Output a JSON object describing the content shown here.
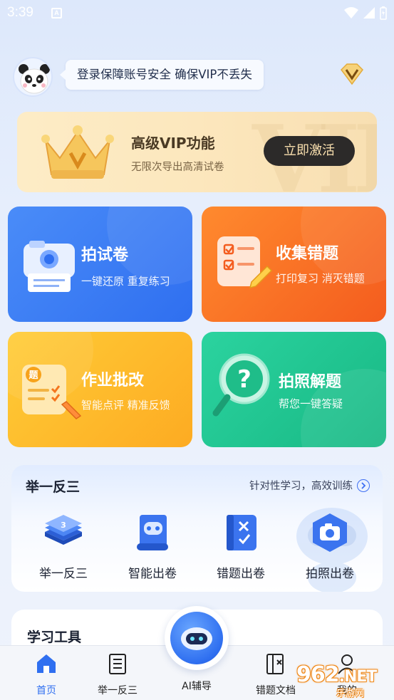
{
  "status_bar": {
    "time": "3:39",
    "notification_glyph": "A"
  },
  "header": {
    "notice": "登录保障账号安全 确保VIP不丢失"
  },
  "vip_banner": {
    "title": "高级VIP功能",
    "subtitle": "无限次导出高清试卷",
    "button": "立即激活",
    "watermark_text": "VIP"
  },
  "cards": [
    {
      "title": "拍试卷",
      "subtitle": "一键还原 重复练习",
      "icon": "camera-scan-icon",
      "color": "#3a7df5"
    },
    {
      "title": "收集错题",
      "subtitle": "打印复习 消灭错题",
      "icon": "checklist-icon",
      "color": "#f76c24"
    },
    {
      "title": "作业批改",
      "subtitle": "智能点评 精准反馈",
      "icon": "homework-check-icon",
      "color": "#fdb92b"
    },
    {
      "title": "拍照解题",
      "subtitle": "帮您一键答疑",
      "icon": "question-search-icon",
      "color": "#20c690"
    }
  ],
  "practice_section": {
    "title": "举一反三",
    "more": "针对性学习，高效训练",
    "tools": [
      {
        "label": "举一反三",
        "icon": "stack-icon"
      },
      {
        "label": "智能出卷",
        "icon": "robot-scroll-icon"
      },
      {
        "label": "错题出卷",
        "icon": "wrong-question-book-icon"
      },
      {
        "label": "拍照出卷",
        "icon": "camera-hexagon-icon"
      }
    ]
  },
  "tools_section": {
    "title": "学习工具"
  },
  "bottom_nav": [
    {
      "label": "首页",
      "icon": "home-icon",
      "active": true
    },
    {
      "label": "举一反三",
      "icon": "list-doc-icon",
      "active": false
    },
    {
      "label": "AI辅导",
      "icon": "ai-robot-icon",
      "active": false
    },
    {
      "label": "错题文档",
      "icon": "wrong-doc-icon",
      "active": false
    },
    {
      "label": "我的",
      "icon": "profile-icon",
      "active": false
    }
  ],
  "watermark": {
    "number": "962",
    "suffix": ".NET",
    "sub": "乐游网"
  }
}
